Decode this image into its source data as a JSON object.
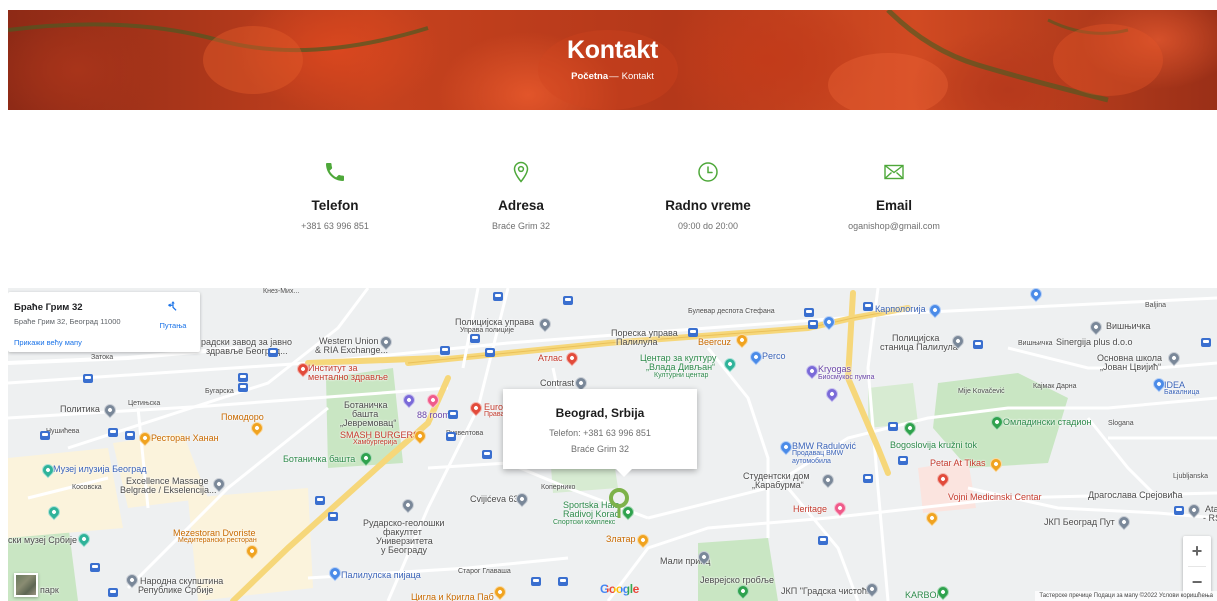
{
  "hero": {
    "title": "Kontakt",
    "breadcrumb_home": "Početna",
    "breadcrumb_sep": "—",
    "breadcrumb_current": "Kontakt"
  },
  "contact_items": [
    {
      "icon": "phone-icon",
      "label": "Telefon",
      "value": "+381 63 996 851"
    },
    {
      "icon": "location-pin-icon",
      "label": "Adresa",
      "value": "Braće Grim 32"
    },
    {
      "icon": "clock-icon",
      "label": "Radno vreme",
      "value": "09:00 do 20:00"
    },
    {
      "icon": "envelope-icon",
      "label": "Email",
      "value": "oganishop@gmail.com"
    }
  ],
  "colors": {
    "accent_green": "#4ea83a",
    "hero_red": "#c6421e",
    "map_road": "#f6d77a",
    "map_park": "#c9e6c3"
  },
  "map": {
    "place_card": {
      "name": "Браће Грим 32",
      "address": "Браће Грим 32, Београд 11000",
      "directions_label": "Путања",
      "larger_map_link": "Прикажи већу мапу"
    },
    "info_window": {
      "title": "Beograd, Srbija",
      "phone": "Telefon: +381 63 996 851",
      "address": "Braće Grim 32"
    },
    "zoom_in": "+",
    "zoom_out": "−",
    "google_logo": "Google",
    "footer": "Тастерске пречице   Подаци за мапу ©2022   Услови коришћења",
    "labels": {
      "l1": "Кнез-Мих...",
      "l2": "радски завод за јавно",
      "l3": "здравље Београд...",
      "l4": "Western Union",
      "l5": "& RIA Exchange...",
      "l6": "Полицијска управа",
      "l7": "Управа полиције",
      "l8": "Пореска управа",
      "l9": "Палилула",
      "l10": "Beercuz",
      "l11": "Карпологија",
      "l12": "Вишњичка",
      "l13": "Полицијска",
      "l14": "станица Палилула",
      "l15": "Sinergija plus d.o.o",
      "l16": "Основна школа",
      "l17": "„Јован Цвијић“",
      "l18": "Затока",
      "l19": "Институт за",
      "l20": "ментално здравље",
      "l21": "Атлас",
      "l22": "Центар за културу",
      "l23": "„Влада Дивљан“",
      "l24": "Културни центар",
      "l25": "Perco",
      "l26": "Kryogas",
      "l27": "Биосмукос пумпа",
      "l28": "Contrast",
      "l29": "IDEA",
      "l30": "Бакалница",
      "l31": "Политика",
      "l32": "Ботаничка",
      "l33": "башта",
      "l34": "„Јевремовац“",
      "l35": "88 rooms",
      "l36": "Europ",
      "l37": "Права",
      "l38": "Помодоро",
      "l39": "SMASH BURGERS",
      "l40": "Хамбургерија",
      "l41": "Ботаничка башта",
      "l42": "Омладински стадион",
      "l43": "Ресторан Ханан",
      "l44": "Bogoslovija kružni tok",
      "l45": "BMW Radulović",
      "l46": "Продавац BMW",
      "l47": "аутомобила",
      "l48": "Музеј илузија Београд",
      "l49": "Petar At Tikas",
      "l50": "Студентски дом",
      "l51": "„Карабурма“",
      "l52": "Excellence Massage",
      "l53": "Belgrade / Ekselencija...",
      "l54": "Cvijićeva 63",
      "l55": "Sportska Hala",
      "l56": "Radivoj Korać",
      "l57": "Спортски комплекс",
      "l58": "Heritage",
      "l59": "Vojni Medicinski Centar",
      "l60": "ЈКП Београд Пут",
      "l61": "Драгослава Срејовића",
      "l62": "Ata",
      "l63": "- RS",
      "l64": "Mezestoran Dvoriste",
      "l65": "Медитерански ресторан",
      "l66": "Рударско-геолошки",
      "l67": "факултет",
      "l68": "Универзитета",
      "l69": "у Београду",
      "l70": "Златар",
      "l71": "Мали принц",
      "l72": "ски музеј Србије",
      "l73": "Народна скупштина",
      "l74": "Републике Србије",
      "l75": "Палилулска пијаца",
      "l76": "Јеврејско гробље",
      "l77": "Цигла и Кригла Паб",
      "l78": "ЈКП \"Градска чистоћа\"",
      "l79": "KARBON",
      "l80": "Mije Kovačević",
      "l81": "Ljubljanska",
      "l82": "Slogana",
      "l83": "Кајмак Дарна",
      "l84": "Копернико",
      "l85": "Старог Главаша",
      "l86": "Нушићева",
      "l87": "Косовска",
      "l88": "Baljina",
      "l89": "Вишњичка",
      "l90": "парк",
      "l91": "Цетињска",
      "l92": "Бугарска",
      "l93": "Рузвелтова",
      "l94": "Булевар деспота Стефана"
    }
  }
}
